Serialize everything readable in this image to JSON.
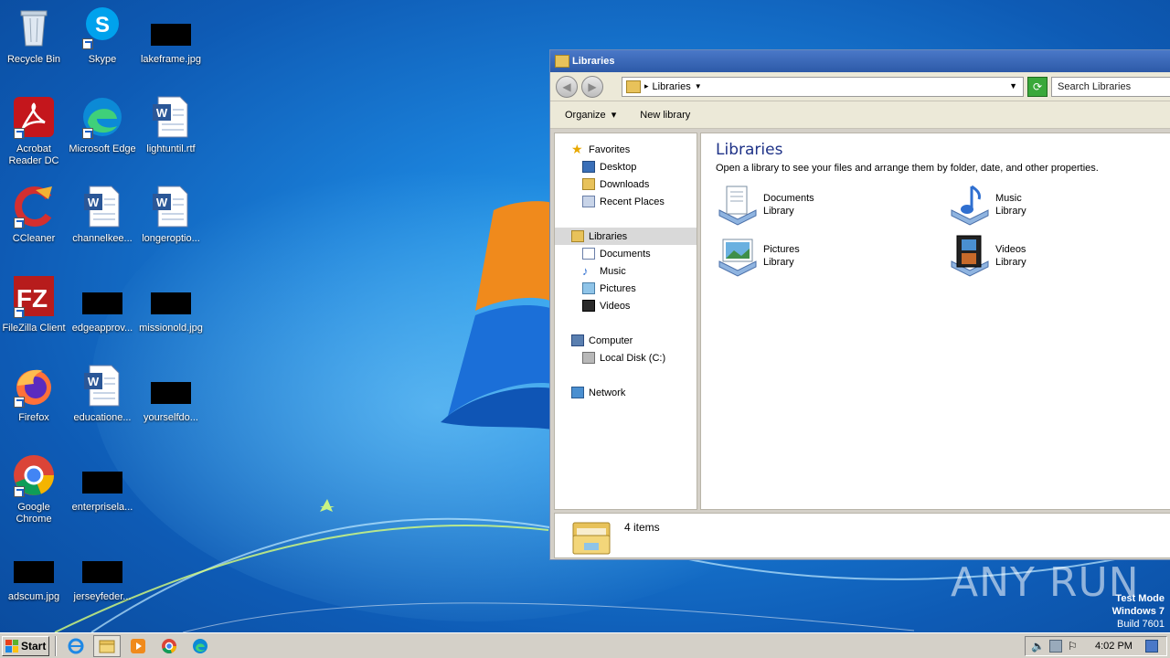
{
  "desktop": {
    "icons": [
      {
        "label": "Recycle Bin",
        "icon": "recycle-bin-icon"
      },
      {
        "label": "Skype",
        "icon": "skype-icon"
      },
      {
        "label": "lakeframe.jpg",
        "icon": "image-file-icon"
      },
      {
        "label": "Acrobat Reader DC",
        "icon": "acrobat-icon"
      },
      {
        "label": "Microsoft Edge",
        "icon": "edge-icon"
      },
      {
        "label": "lightuntil.rtf",
        "icon": "word-document-icon"
      },
      {
        "label": "CCleaner",
        "icon": "ccleaner-icon"
      },
      {
        "label": "channelkee...",
        "icon": "word-document-icon"
      },
      {
        "label": "longeroptio...",
        "icon": "word-document-icon"
      },
      {
        "label": "FileZilla Client",
        "icon": "filezilla-icon"
      },
      {
        "label": "edgeapprov...",
        "icon": "image-file-icon"
      },
      {
        "label": "missionold.jpg",
        "icon": "image-file-icon"
      },
      {
        "label": "Firefox",
        "icon": "firefox-icon"
      },
      {
        "label": "educatione...",
        "icon": "word-document-icon"
      },
      {
        "label": "yourselfdo...",
        "icon": "image-file-icon"
      },
      {
        "label": "Google Chrome",
        "icon": "chrome-icon"
      },
      {
        "label": "enterprisela...",
        "icon": "image-file-icon"
      },
      {
        "label": "adscum.jpg",
        "icon": "image-file-icon"
      },
      {
        "label": "jerseyfeder...",
        "icon": "image-file-icon"
      }
    ]
  },
  "window": {
    "title": "Libraries",
    "address": {
      "crumb": "Libraries",
      "crumb_arrow": "▸"
    },
    "search_placeholder": "Search Libraries",
    "toolbar": {
      "organize": "Organize",
      "new_library": "New library"
    },
    "nav": {
      "favorites": "Favorites",
      "desktop": "Desktop",
      "downloads": "Downloads",
      "recent_places": "Recent Places",
      "libraries": "Libraries",
      "documents": "Documents",
      "music": "Music",
      "pictures": "Pictures",
      "videos": "Videos",
      "computer": "Computer",
      "local_disk": "Local Disk (C:)",
      "network": "Network"
    },
    "content": {
      "heading": "Libraries",
      "description": "Open a library to see your files and arrange them by folder, date, and other properties.",
      "libraries": [
        {
          "name": "Documents",
          "type": "Library",
          "icon": "documents-library-icon"
        },
        {
          "name": "Music",
          "type": "Library",
          "icon": "music-library-icon"
        },
        {
          "name": "Pictures",
          "type": "Library",
          "icon": "pictures-library-icon"
        },
        {
          "name": "Videos",
          "type": "Library",
          "icon": "videos-library-icon"
        }
      ]
    },
    "status": "4 items"
  },
  "watermark": {
    "brand": "ANY RUN",
    "test_mode": "Test Mode",
    "os": "Windows 7",
    "build": "Build 7601"
  },
  "taskbar": {
    "start": "Start",
    "clock": "4:02 PM"
  },
  "colors": {
    "heading_blue": "#1e3287",
    "titlebar": "#2d5aa8"
  }
}
